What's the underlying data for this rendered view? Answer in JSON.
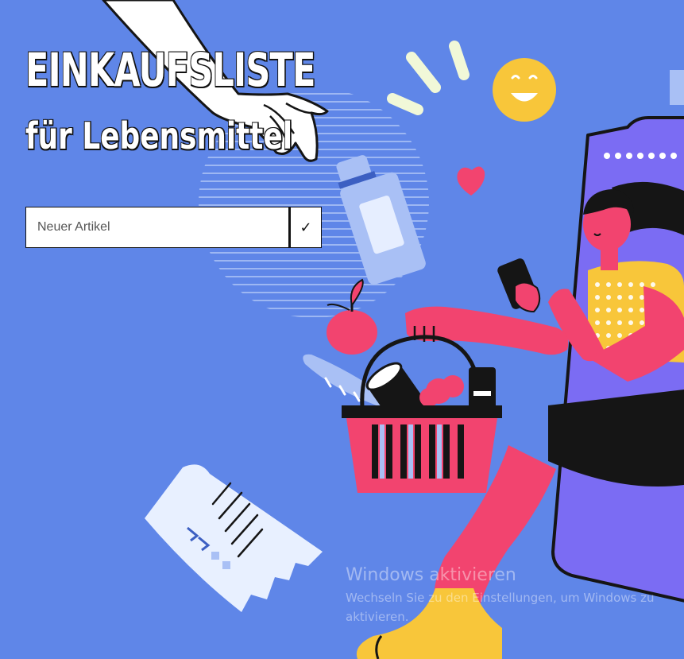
{
  "title": {
    "main": "EINKAUFSLISTE",
    "sub": "für Lebensmittel"
  },
  "form": {
    "input_placeholder": "Neuer Artikel",
    "input_value": "",
    "submit_label": "✓"
  },
  "watermark": {
    "title": "Windows aktivieren",
    "text": "Wechseln Sie zu den Einstellungen, um Windows zu aktivieren."
  },
  "colors": {
    "background": "#5f86e8",
    "accent_pink": "#f2446f",
    "accent_yellow": "#f8c63a",
    "phone_purple": "#7b6cf3",
    "light_blue": "#a9c0f5",
    "dark": "#151515"
  },
  "illustration": {
    "icons": [
      "hand-icon",
      "smiley-icon",
      "heart-icon",
      "bottle-icon",
      "apple-icon",
      "bread-icon",
      "basket-icon",
      "receipt-icon",
      "phone-icon",
      "woman-icon"
    ]
  }
}
